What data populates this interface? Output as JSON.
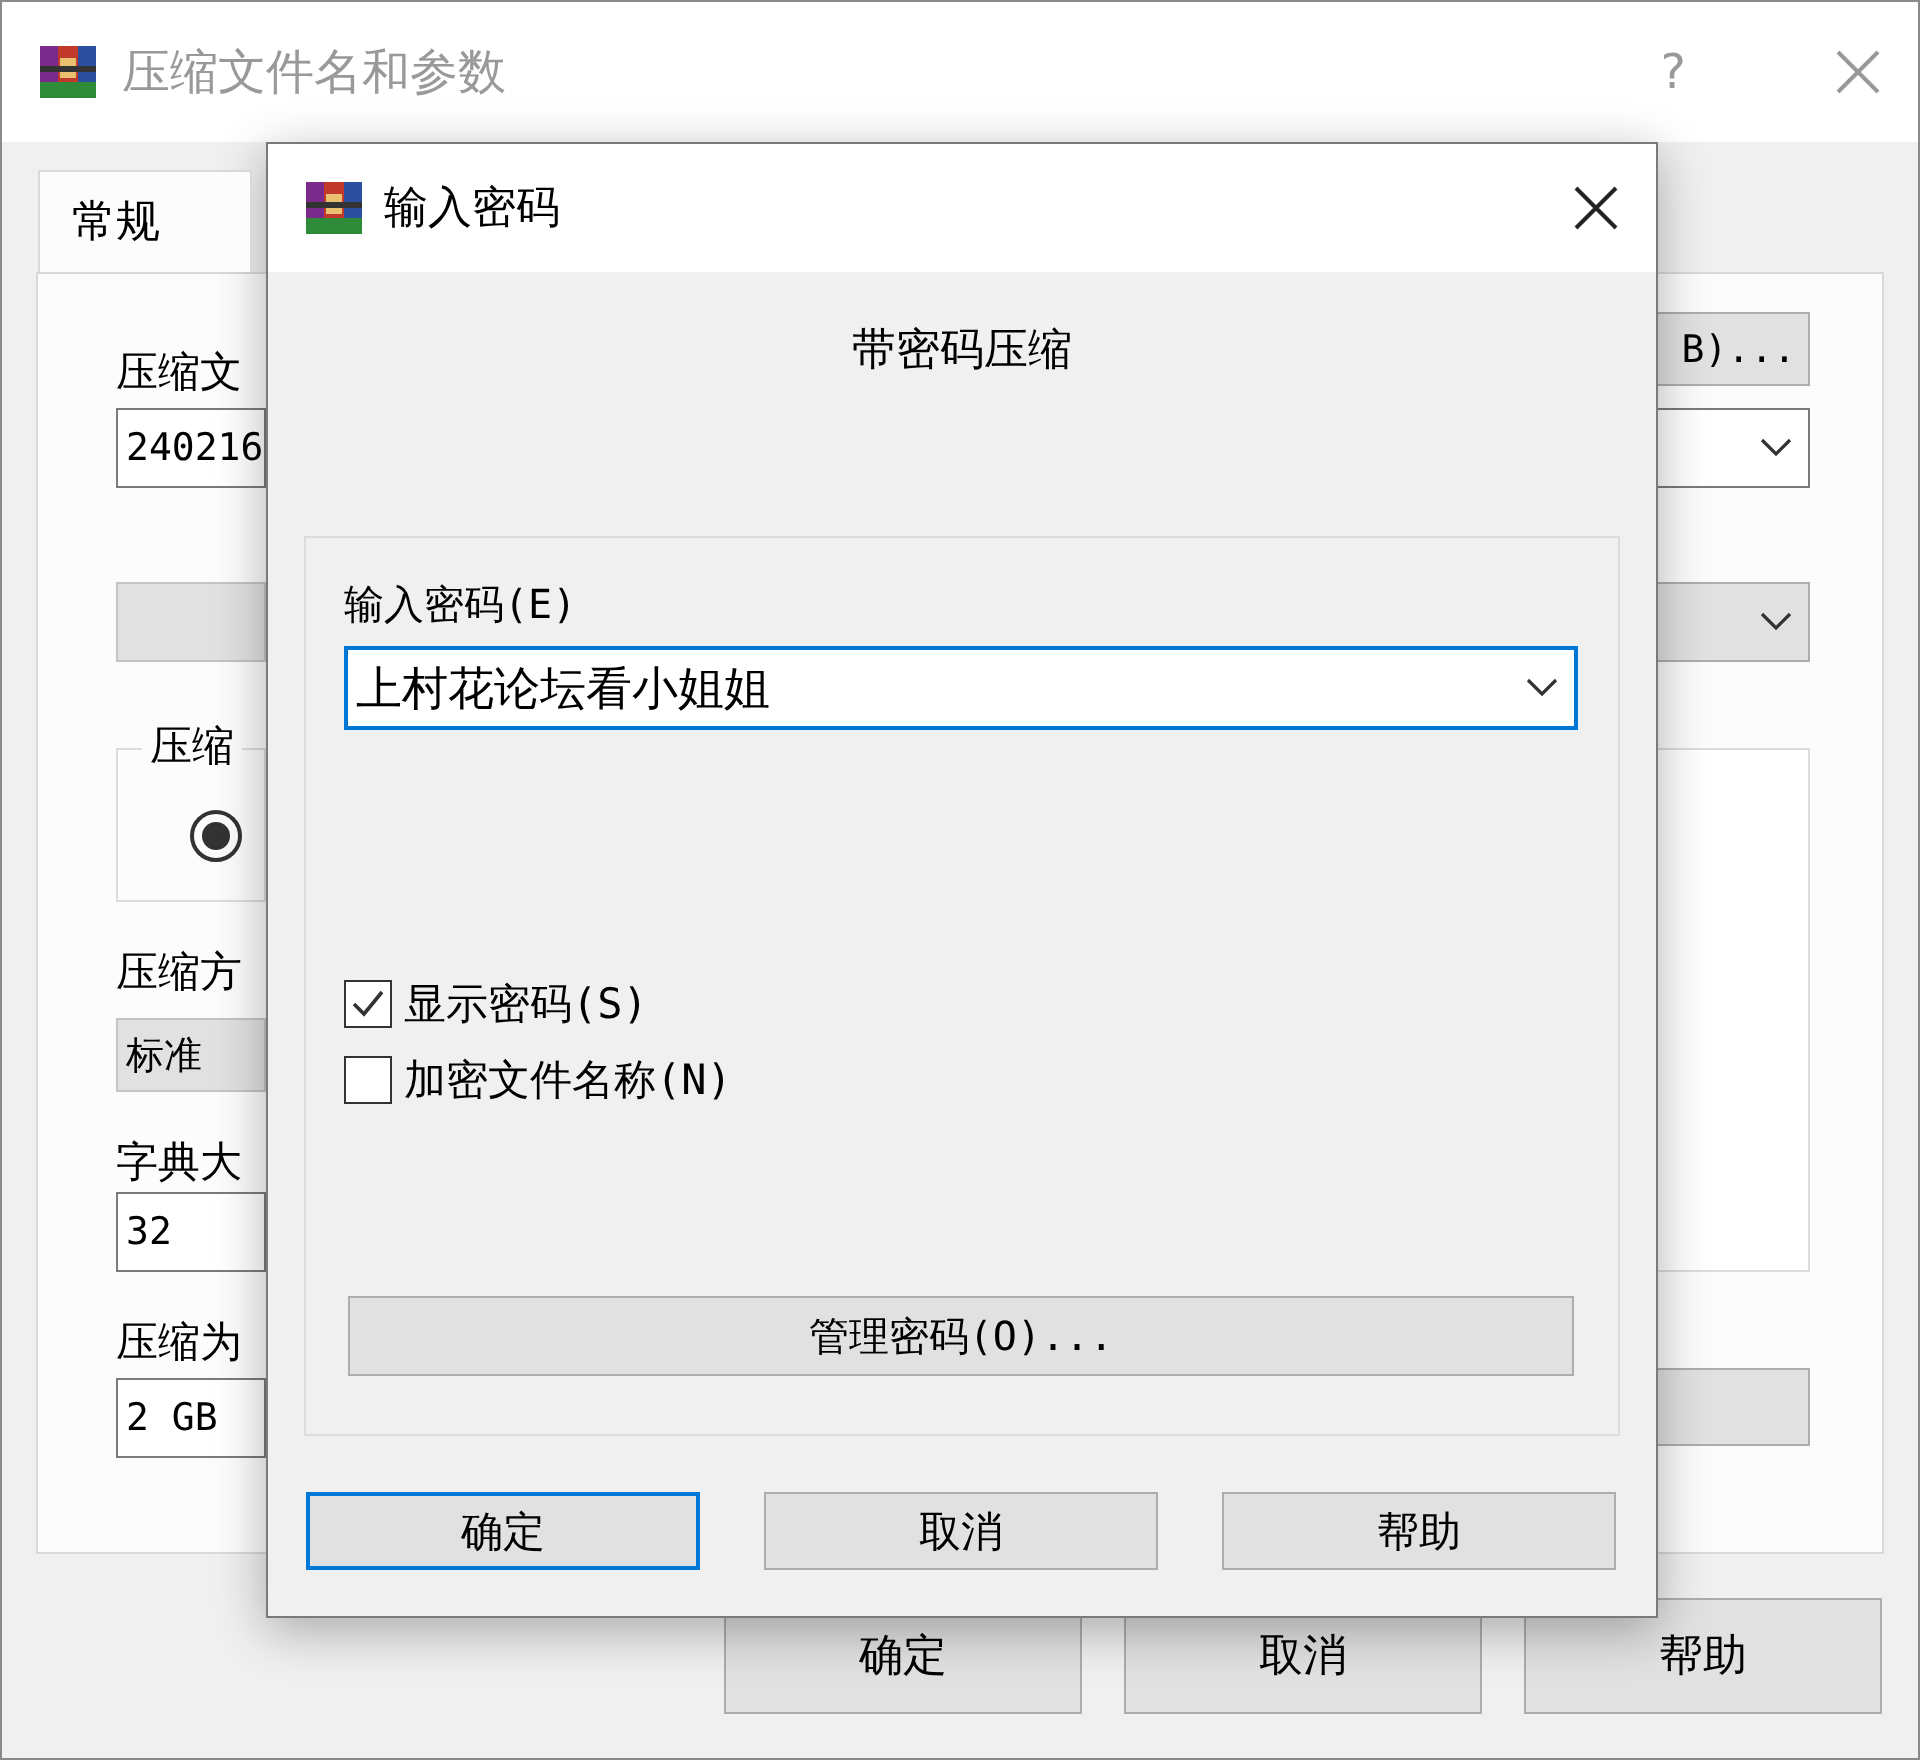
{
  "window": {
    "title": "压缩文件名和参数",
    "help": "?"
  },
  "tabs": [
    {
      "label": "常规",
      "selected": true
    }
  ],
  "main_panel": {
    "archive_name_label": "压缩文",
    "archive_name": "240216",
    "browse_button": "B)...",
    "group_label": "压缩",
    "radio": {
      "selected": true
    },
    "method_label": "压缩方",
    "method": "标准",
    "dictionary_label": "字典大",
    "dictionary": "32",
    "split_label": "压缩为",
    "split": "2 GB"
  },
  "buttons": [
    {
      "label": "确定"
    },
    {
      "label": "取消"
    },
    {
      "label": "帮助"
    }
  ],
  "dialog": {
    "title": "输入密码",
    "heading": "带密码压缩",
    "password_label": "输入密码(E)",
    "password": "上村花论坛看小姐姐",
    "options": [
      {
        "label": "显示密码(S)",
        "checked": true
      },
      {
        "label": "加密文件名称(N)",
        "checked": false
      }
    ],
    "manage_button": "管理密码(O)...",
    "buttons": [
      {
        "label": "确定",
        "default": true
      },
      {
        "label": "取消",
        "default": false
      },
      {
        "label": "帮助",
        "default": false
      }
    ]
  }
}
